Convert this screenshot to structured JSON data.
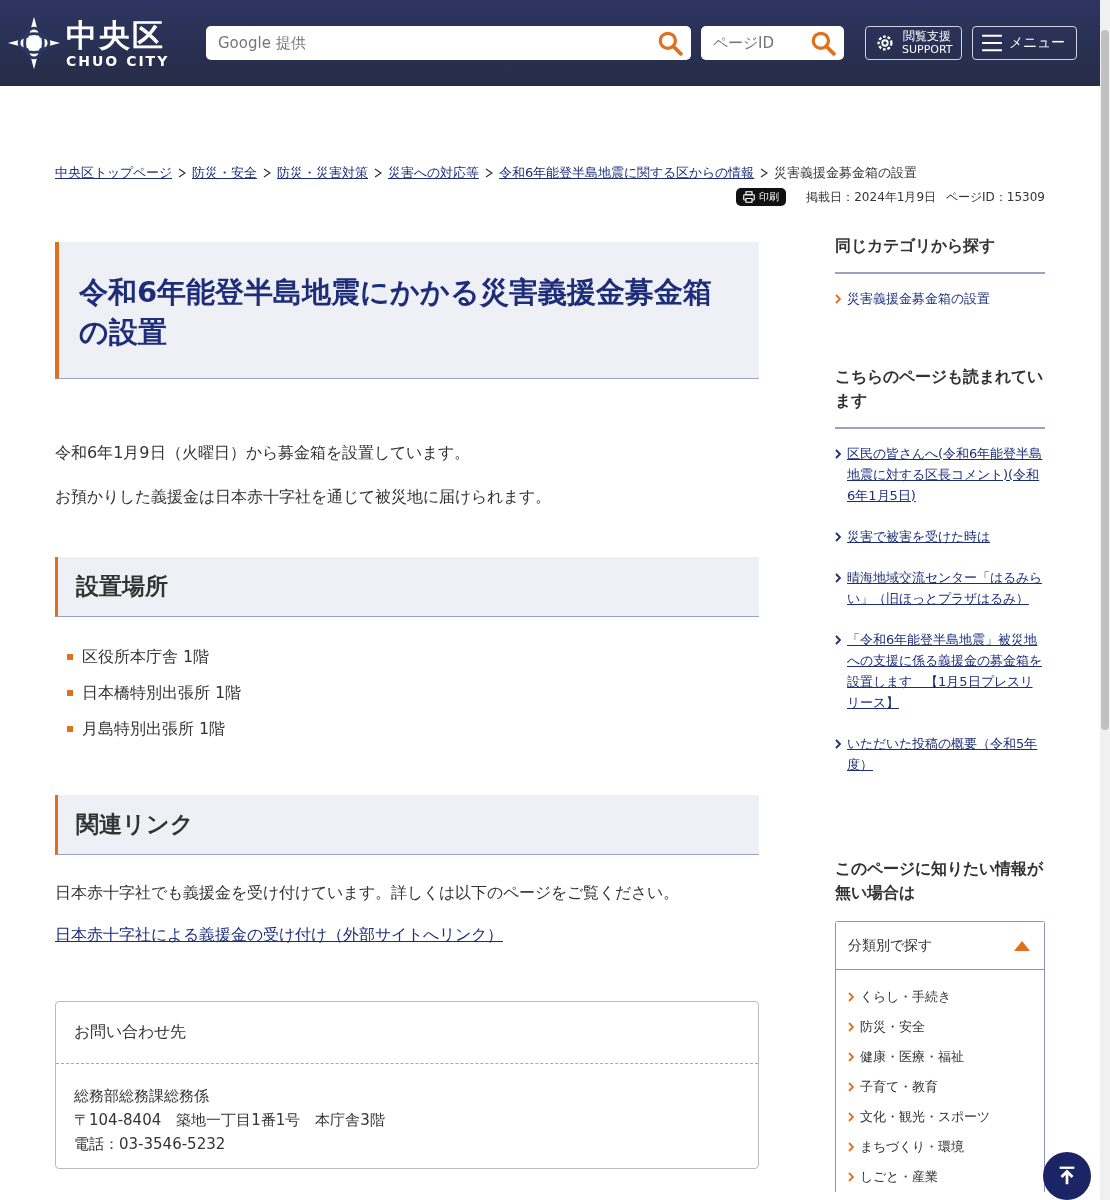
{
  "header": {
    "logo_title": "中央区",
    "logo_subtitle": "CHUO CITY",
    "search": {
      "placeholder": "Google 提供"
    },
    "page_id_search": {
      "placeholder": "ページID"
    },
    "support_button": [
      "閲覧支援",
      "SUPPORT"
    ],
    "menu_button": "メニュー"
  },
  "breadcrumbs": [
    {
      "label": "中央区トップページ",
      "link": true
    },
    {
      "label": "防災・安全",
      "link": true
    },
    {
      "label": "防災・災害対策",
      "link": true
    },
    {
      "label": "災害への対応等",
      "link": true
    },
    {
      "label": "令和6年能登半島地震に関する区からの情報",
      "link": true
    },
    {
      "label": "災害義援金募金箱の設置",
      "link": false
    }
  ],
  "print_button": "印刷",
  "published": "掲載日：2024年1月9日",
  "page_id": "ページID：15309",
  "title": "令和6年能登半島地震にかかる災害義援金募金箱の設置",
  "intro": [
    "令和6年1月9日（火曜日）から募金箱を設置しています。",
    "お預かりした義援金は日本赤十字社を通じて被災地に届けられます。"
  ],
  "sections": [
    {
      "heading": "設置場所",
      "kind": "list",
      "items": [
        "区役所本庁舎 1階",
        "日本橋特別出張所 1階",
        "月島特別出張所 1階"
      ]
    },
    {
      "heading": "関連リンク",
      "kind": "links",
      "text": "日本赤十字社でも義援金を受け付けています。詳しくは以下のページをご覧ください。",
      "link": "日本赤十字社による義援金の受け付け（外部サイトへリンク）"
    }
  ],
  "contact": {
    "heading": "お問い合わせ先",
    "lines": [
      "総務部総務課総務係",
      "〒104-8404　築地一丁目1番1号　本庁舎3階",
      "電話：03-3546-5232"
    ]
  },
  "sidebar": {
    "same_category": {
      "heading": "同じカテゴリから探す",
      "items": [
        {
          "label": "災害義援金募金箱の設置",
          "current": true
        }
      ]
    },
    "also_read": {
      "heading": "こちらのページも読まれています",
      "items": [
        {
          "label": "区民の皆さんへ(令和6年能登半島地震に対する区長コメント)(令和6年1月5日)",
          "current": false
        },
        {
          "label": "災害で被害を受けた時は",
          "current": false
        },
        {
          "label": "晴海地域交流センター「はるみらい」（旧ほっとプラザはるみ）",
          "current": false
        },
        {
          "label": "「令和6年能登半島地震」被災地への支援に係る義援金の募金箱を設置します　【1月5日プレスリリース】",
          "current": false
        },
        {
          "label": "いただいた投稿の概要（令和5年度）",
          "current": false
        }
      ]
    },
    "not_found": {
      "heading": "このページに知りたい情報が無い場合は",
      "accordion": {
        "label": "分類別で探す",
        "expanded": true,
        "items": [
          "くらし・手続き",
          "防災・安全",
          "健康・医療・福祉",
          "子育て・教育",
          "文化・観光・スポーツ",
          "まちづくり・環境",
          "しごと・産業"
        ]
      }
    }
  }
}
